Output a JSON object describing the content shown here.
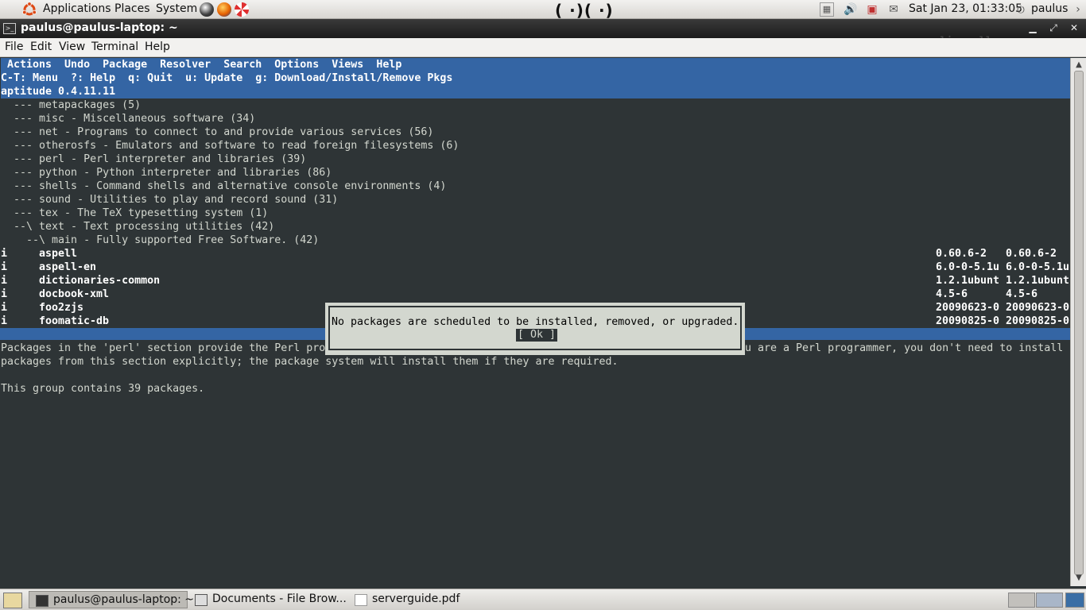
{
  "top_panel": {
    "menus": [
      "Applications",
      "Places",
      "System"
    ],
    "center_logo": "( ·)( ·)",
    "clock": "Sat Jan 23, 01:33:05",
    "user": "paulus"
  },
  "window": {
    "title": "paulus@paulus-laptop: ~",
    "watermark": "onlinewallpapers.co"
  },
  "menubar": {
    "items": [
      "File",
      "Edit",
      "View",
      "Terminal",
      "Help"
    ]
  },
  "terminal": {
    "menu_line": " Actions  Undo  Package  Resolver  Search  Options  Views  Help",
    "key_line": "C-T: Menu  ?: Help  q: Quit  u: Update  g: Download/Install/Remove Pkgs",
    "version_line": "aptitude 0.4.11.11",
    "tree": [
      "  --- metapackages (5)",
      "  --- misc - Miscellaneous software (34)",
      "  --- net - Programs to connect to and provide various services (56)",
      "  --- otherosfs - Emulators and software to read foreign filesystems (6)",
      "  --- perl - Perl interpreter and libraries (39)",
      "  --- python - Python interpreter and libraries (86)",
      "  --- shells - Command shells and alternative console environments (4)",
      "  --- sound - Utilities to play and record sound (31)",
      "  --- tex - The TeX typesetting system (1)",
      "  --\\ text - Text processing utilities (42)",
      "    --\\ main - Fully supported Free Software. (42)"
    ],
    "packages": [
      {
        "state": "i",
        "name": "aspell",
        "current": "0.60.6-2",
        "candidate": "0.60.6-2"
      },
      {
        "state": "i",
        "name": "aspell-en",
        "current": "6.0-0-5.1u",
        "candidate": "6.0-0-5.1u"
      },
      {
        "state": "i",
        "name": "dictionaries-common",
        "current": "1.2.1ubunt",
        "candidate": "1.2.1ubunt"
      },
      {
        "state": "i",
        "name": "docbook-xml",
        "current": "4.5-6",
        "candidate": "4.5-6"
      },
      {
        "state": "i",
        "name": "foo2zjs",
        "current": "20090623-0",
        "candidate": "20090623-0"
      },
      {
        "state": "i",
        "name": "foomatic-db",
        "current": "20090825-0",
        "candidate": "20090825-0"
      }
    ],
    "desc_line1_left": "Packages in the 'perl' section provide the Perl pro",
    "desc_line1_right": "u are a Perl programmer, you don't need to install",
    "desc_line2": "packages from this section explicitly; the package system will install them if they are required.",
    "desc_line3": "This group contains 39 packages."
  },
  "dialog": {
    "message": "No packages are scheduled to be installed, removed, or upgraded.",
    "ok_label": "[ Ok ]"
  },
  "taskbar": {
    "tasks": [
      "paulus@paulus-laptop: ~",
      "Documents - File Brow...",
      "serverguide.pdf"
    ]
  },
  "colors": {
    "terminal_bg": "#2e3436",
    "aptitude_blue": "#3465a4",
    "dialog_bg": "#d3d7cf"
  }
}
